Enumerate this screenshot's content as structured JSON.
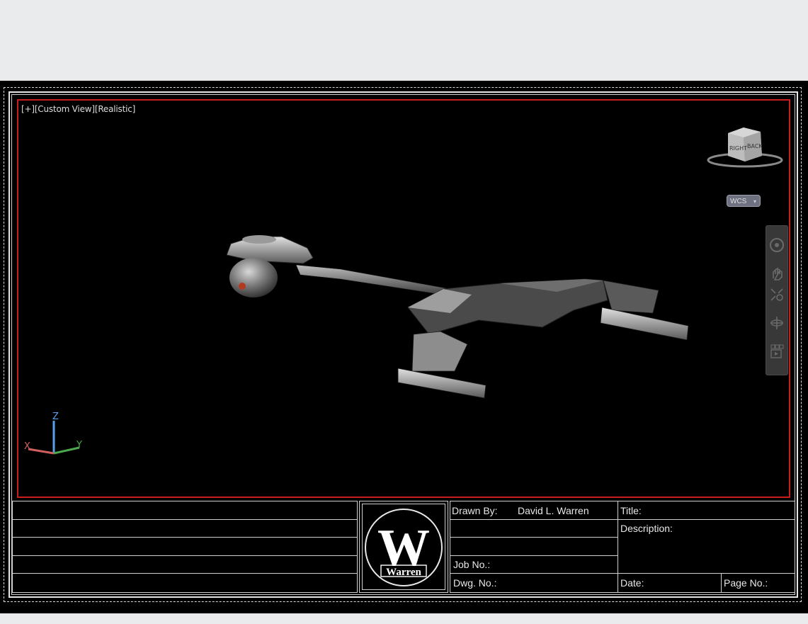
{
  "viewport": {
    "label": "[+][Custom View][Realistic]",
    "wcs_label": "WCS",
    "wcs_caret": "▾",
    "viewcube": {
      "face_right": "RIGHT",
      "face_back": "BACK"
    },
    "ucs": {
      "x_label": "X",
      "y_label": "Y",
      "z_label": "Z"
    },
    "border_color": "#c81d1d"
  },
  "navbar": {
    "icons": [
      "steering-wheel-icon",
      "pan-icon",
      "zoom-extents-icon",
      "orbit-icon",
      "showmotion-icon"
    ]
  },
  "title_block": {
    "drawn_by_label": "Drawn By:",
    "drawn_by_value": "David L. Warren",
    "title_label": "Title:",
    "description_label": "Description:",
    "job_no_label": "Job No.:",
    "dwg_no_label": "Dwg. No.:",
    "date_label": "Date:",
    "page_no_label": "Page No.:",
    "logo_letter": "W",
    "logo_name": "Warren"
  }
}
